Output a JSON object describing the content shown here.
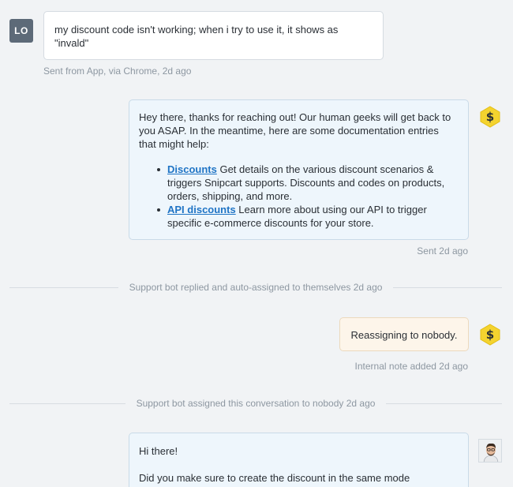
{
  "user_message": {
    "avatar_initials": "LO",
    "text": "my discount code isn't working; when i try to use it, it shows as \"invald\"",
    "meta": "Sent from App, via Chrome, 2d ago"
  },
  "bot_message": {
    "intro": "Hey there, thanks for reaching out! Our human geeks will get back to you ASAP. In the meantime, here are some documentation entries that might help:",
    "items": [
      {
        "link": "Discounts",
        "desc": " Get details on the various discount scenarios & triggers Snipcart supports. Discounts and codes on products, orders, shipping, and more."
      },
      {
        "link": "API discounts",
        "desc": " Learn more about using our API to trigger specific e-commerce discounts for your store."
      }
    ],
    "meta": "Sent 2d ago",
    "avatar_icon": "snipcart-dollar-hex-icon"
  },
  "divider_1": "Support bot replied and auto-assigned to themselves 2d ago",
  "note_message": {
    "text": "Reassigning to nobody.",
    "meta": "Internal note added 2d ago",
    "avatar_icon": "snipcart-dollar-hex-icon"
  },
  "divider_2": "Support bot assigned this conversation to nobody 2d ago",
  "agent_message": {
    "greeting": "Hi there!",
    "body": "Did you make sure to create the discount in the same mode"
  },
  "colors": {
    "background": "#f1f3f5",
    "bot_bubble": "#eef6fc",
    "note_bubble": "#fdf5ea",
    "link": "#1f74c5",
    "hex_badge": "#f4d32f"
  }
}
